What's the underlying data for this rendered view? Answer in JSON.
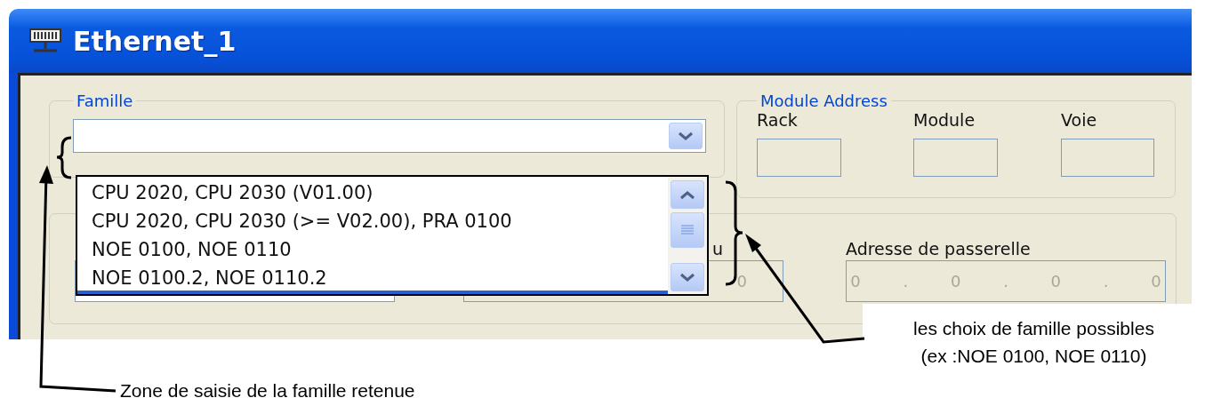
{
  "window": {
    "title": "Ethernet_1"
  },
  "famille": {
    "legend": "Famille",
    "options": [
      {
        "label": "CPU 2020, CPU 2030 (V01.00)"
      },
      {
        "label": "CPU 2020, CPU 2030 (>= V02.00), PRA 0100"
      },
      {
        "label": "NOE 0100, NOE 0110"
      },
      {
        "label": "NOE 0100.2, NOE 0110.2"
      }
    ]
  },
  "module_address": {
    "legend": "Module Address",
    "fields": [
      {
        "label": "Rack"
      },
      {
        "label": "Module"
      },
      {
        "label": "Voie"
      }
    ]
  },
  "network": {
    "fields": [
      {
        "disabled": false
      },
      {
        "label": "u",
        "value": "0",
        "disabled": true
      },
      {
        "label": "Adresse de passerelle",
        "value": "0 . 0 . 0 . 0",
        "disabled": true
      }
    ]
  },
  "annotations": {
    "list_note": [
      "les choix de famille possibles",
      "(ex :NOE 0100, NOE 0110)"
    ],
    "field_note": "Zone de saisie de la famille retenue"
  }
}
